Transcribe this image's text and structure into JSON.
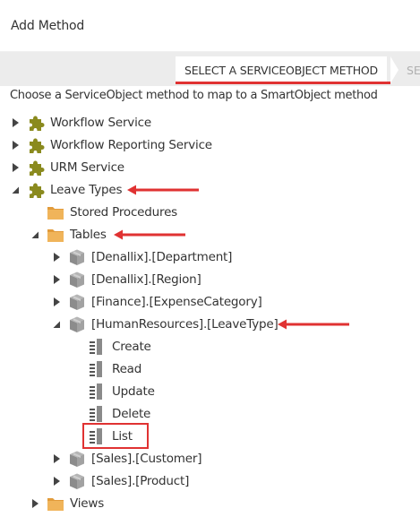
{
  "header": {
    "title": "Add Method"
  },
  "wizard": {
    "active_step": "SELECT A SERVICEOBJECT METHOD",
    "next_step": "SE"
  },
  "instruction": "Choose a ServiceObject method to map to a SmartObject method",
  "tree": {
    "workflow_service": "Workflow Service",
    "workflow_reporting_service": "Workflow Reporting Service",
    "urm_service": "URM Service",
    "leave_types": "Leave Types",
    "stored_procedures": "Stored Procedures",
    "tables": "Tables",
    "department": "[Denallix].[Department]",
    "region": "[Denallix].[Region]",
    "expense_category": "[Finance].[ExpenseCategory]",
    "leave_type": "[HumanResources].[LeaveType]",
    "method_create": "Create",
    "method_read": "Read",
    "method_update": "Update",
    "method_delete": "Delete",
    "method_list": "List",
    "customer": "[Sales].[Customer]",
    "product": "[Sales].[Product]",
    "views": "Views"
  },
  "colors": {
    "accent_red": "#e03232",
    "service_icon": "#8a8a1e",
    "folder_icon": "#f0b45a",
    "object_icon": "#8c8c8c"
  },
  "icons": {
    "service": "puzzle-piece-icon",
    "folder": "folder-icon",
    "object": "cube-icon",
    "method": "method-list-icon",
    "collapsed": "triangle-right-icon",
    "expanded": "triangle-down-icon"
  }
}
